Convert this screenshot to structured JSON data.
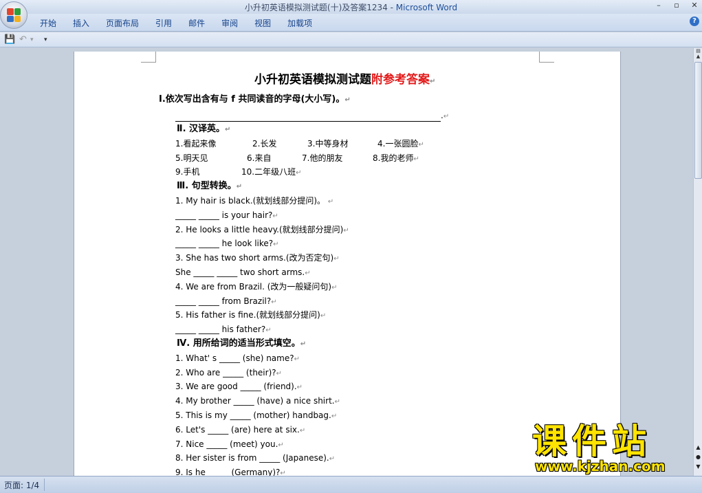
{
  "window": {
    "title_doc": "小升初英语模拟测试题(十)及答案1234",
    "title_sep": " - ",
    "title_app": "Microsoft Word",
    "minimize": "–",
    "restore": "▫",
    "close": "✕"
  },
  "ribbon": {
    "tabs": [
      "开始",
      "插入",
      "页面布局",
      "引用",
      "邮件",
      "审阅",
      "视图",
      "加载项"
    ],
    "help": "?"
  },
  "quick_access": {
    "save_icon": "💾",
    "undo_icon": "↶",
    "undo_drop": "▾",
    "customize": "▾"
  },
  "document": {
    "title_black": "小升初英语模拟测试题",
    "title_red": "附参考答案",
    "section1": "Ⅰ.依次写出含有与 f 共同读音的字母(大小写)。",
    "section2": "Ⅱ. 汉译英。",
    "vocab": [
      [
        "1.看起来像",
        "2.长发",
        "3.中等身材",
        "4.一张圆脸"
      ],
      [
        "5.明天见",
        "6.来自",
        "7.他的朋友",
        "8.我的老师"
      ],
      [
        "9.手机",
        "10.二年级八班"
      ]
    ],
    "section3": "Ⅲ. 句型转换。",
    "s3_lines": [
      "1. My hair is black.(就划线部分提问)。",
      "_____ _____ is your hair?",
      "2. He looks a little heavy.(就划线部分提问)",
      "_____ _____ he look like?",
      "3. She has two short arms.(改为否定句)",
      "She _____ _____ two short arms.",
      "4. We are from Brazil. (改为一般疑问句)",
      "_____ _____ from Brazil?",
      "5. His father is fine.(就划线部分提问)",
      "_____ _____ his father?"
    ],
    "section4": "Ⅳ. 用所给词的适当形式填空。",
    "s4_lines": [
      "1. What' s _____ (she) name?",
      "2. Who are _____ (their)?",
      "3. We are good _____ (friend).",
      "4. My brother _____ (have) a nice shirt.",
      "5. This is my _____ (mother) handbag.",
      "6. Let's _____ (are) here at six.",
      "7. Nice _____ (meet) you.",
      "8. Her sister is from _____ (Japanese).",
      "9. Is he _____ (Germany)?"
    ]
  },
  "status": {
    "page": "页面: 1/4"
  },
  "watermark": {
    "cn": "课件站",
    "url": "www.kjzhan.com"
  },
  "colors": {
    "title_red": "#e31b1b",
    "watermark_yellow": "#ffe400",
    "ribbon_text": "#15428b"
  }
}
